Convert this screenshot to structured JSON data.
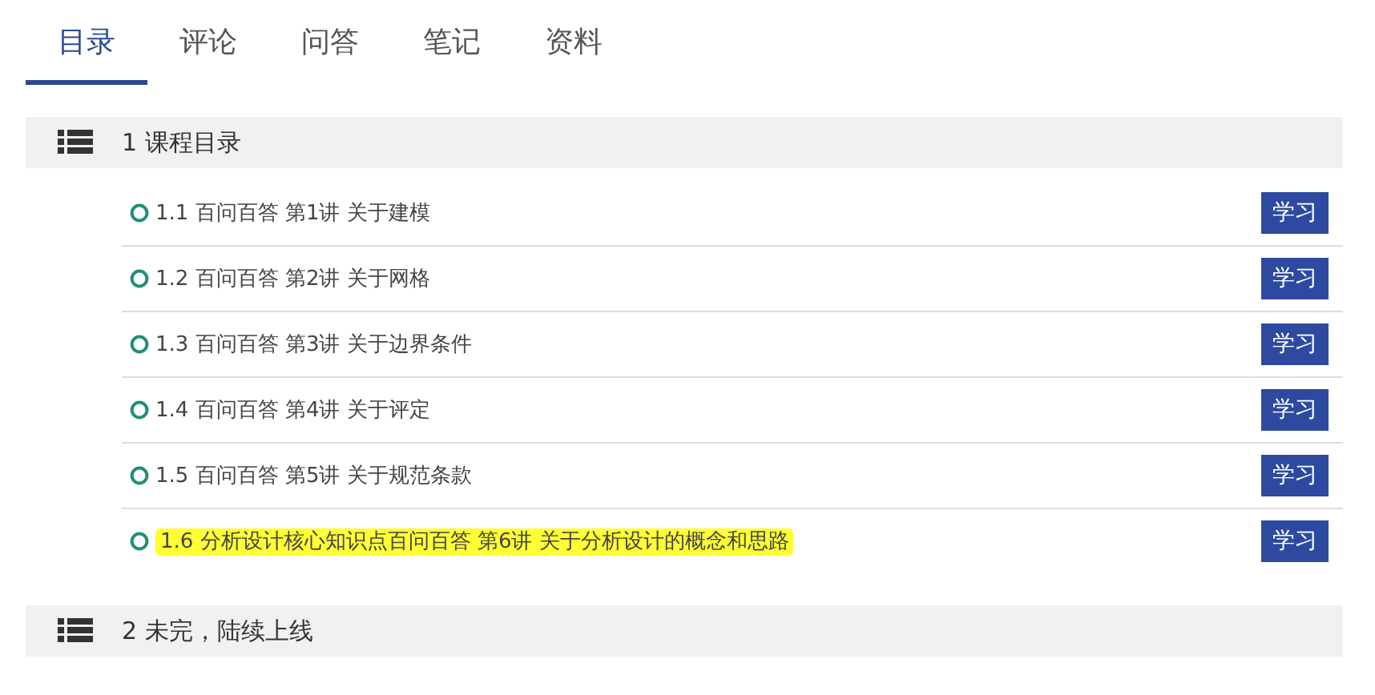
{
  "tabs": [
    {
      "label": "目录",
      "selected": true
    },
    {
      "label": "评论",
      "selected": false
    },
    {
      "label": "问答",
      "selected": false
    },
    {
      "label": "笔记",
      "selected": false
    },
    {
      "label": "资料",
      "selected": false
    }
  ],
  "chapters": [
    {
      "title": "1 课程目录",
      "lessons": [
        {
          "title": "1.1 百问百答 第1讲 关于建模",
          "button": "学习",
          "highlighted": false
        },
        {
          "title": "1.2 百问百答 第2讲 关于网格",
          "button": "学习",
          "highlighted": false
        },
        {
          "title": "1.3 百问百答 第3讲 关于边界条件",
          "button": "学习",
          "highlighted": false
        },
        {
          "title": "1.4 百问百答 第4讲 关于评定",
          "button": "学习",
          "highlighted": false
        },
        {
          "title": "1.5 百问百答 第5讲 关于规范条款",
          "button": "学习",
          "highlighted": false
        },
        {
          "title": "1.6 分析设计核心知识点百问百答 第6讲 关于分析设计的概念和思路",
          "button": "学习",
          "highlighted": true
        }
      ]
    },
    {
      "title": "2 未完，陆续上线"
    }
  ]
}
